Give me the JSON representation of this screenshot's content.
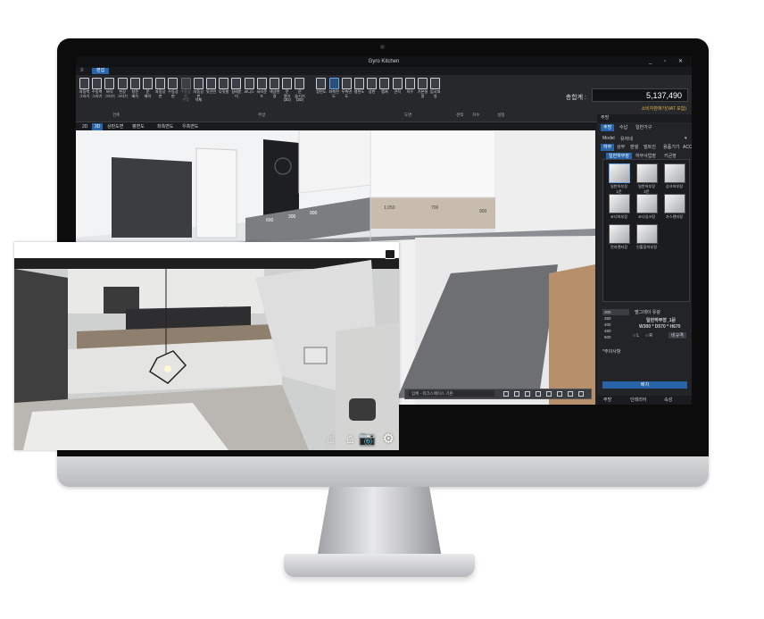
{
  "window": {
    "title": "Gyro Kitchen",
    "controls": "_ ▫ ✕"
  },
  "menu": {
    "active_tab": "편집",
    "quick_icon": "≡"
  },
  "ribbon": {
    "buttons": [
      {
        "label": "자동벽\n그리기"
      },
      {
        "label": "수동벽\n그리기"
      },
      {
        "label": "바닥\n그리기"
      },
      {
        "label": "천장\n그리기"
      },
      {
        "label": "창문\n배치"
      },
      {
        "label": "문\n배치"
      },
      {
        "label": "자동상판"
      },
      {
        "label": "수동상판"
      },
      {
        "label": "수동상판\n수정",
        "dim": true
      },
      {
        "label": "자동상판\n삭제"
      },
      {
        "label": "뒷선반"
      },
      {
        "label": "다릿발"
      },
      {
        "label": "걸레받이"
      },
      {
        "label": "코니스"
      },
      {
        "label": "서라운드"
      },
      {
        "label": "색상변경"
      },
      {
        "label": "문\n열기(3D)"
      },
      {
        "label": "문\n숨기기(3D)"
      },
      {
        "label": "정면도"
      },
      {
        "label": "좌측면도",
        "sel": true
      },
      {
        "label": "우측면도"
      },
      {
        "label": "평면도"
      },
      {
        "label": "상판"
      },
      {
        "label": "캡쳐"
      },
      {
        "label": "견적"
      },
      {
        "label": "치수"
      },
      {
        "label": "기본설정"
      },
      {
        "label": "임시파일"
      }
    ],
    "groups": [
      "건축",
      "주방",
      "도면",
      "견적",
      "치수",
      "설정"
    ],
    "total_label": "총합계 :",
    "total_value": "5,137,490",
    "total_note": "소비자판매가(VAT 포함)"
  },
  "doc_tabs": [
    "2D",
    "3D",
    "상판도면",
    "평면도",
    "좌측면도",
    "우측면도"
  ],
  "viewport": {
    "dim_labels": [
      "600",
      "300",
      "900",
      "1,050",
      "700",
      "900"
    ],
    "toolbar_select": "입체 - 워크스페이스 기본"
  },
  "panel": {
    "header": "주방",
    "top_tabs": [
      "주방",
      "수납",
      "일반가구"
    ],
    "model_label": "Model",
    "model_value": "유자네",
    "sub_tabs": [
      "하부",
      "상부",
      "판넬",
      "빌트인",
      "용품기기",
      "ACC"
    ],
    "cat_tabs": [
      "일반하부장",
      "하부사업장",
      "키큰장"
    ],
    "items": [
      {
        "label": "일반하부장\n1문"
      },
      {
        "label": "일반하부장\n2문"
      },
      {
        "label": "싱크하부장"
      },
      {
        "label": "코너하부장"
      },
      {
        "label": "코너싱크장"
      },
      {
        "label": "가스렌지장"
      },
      {
        "label": "전자렌지장"
      },
      {
        "label": "인출함하부장"
      }
    ],
    "sizes": [
      "300",
      "350",
      "400",
      "450",
      "500"
    ],
    "color_label": "멜그레이 유광",
    "selected_name": "일반하부장_1문",
    "dimension_text": "W300 * D570 * H670",
    "orient_l": "L",
    "orient_r": "R",
    "detail_button": "비규격",
    "notes_label": "*주의사항",
    "apply_button": "배치",
    "footer_tabs": [
      "주방",
      "인테리어",
      "속성"
    ]
  },
  "colors": {
    "accent": "#2764a8",
    "total_note": "#e3b04b"
  },
  "overlay_icons": [
    "hand-pointer-icon",
    "home-icon",
    "camera-icon",
    "gear-icon"
  ]
}
